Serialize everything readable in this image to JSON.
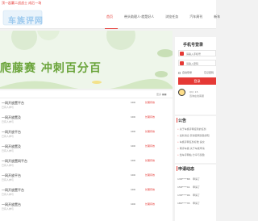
{
  "slogan": "顶一起赢二战战士 成后一场",
  "header": {
    "logo_text": "车族评网",
    "nav": [
      {
        "label": "首页",
        "active": true
      },
      {
        "label": "带头助理人·就是好人",
        "active": false
      },
      {
        "label": "浏览任务",
        "active": false
      },
      {
        "label": "汽车周刊",
        "active": false
      },
      {
        "label": "新车",
        "active": false
      }
    ]
  },
  "banner": {
    "text": "爬藤赛 冲刺百分百"
  },
  "login": {
    "title": "手机号登录",
    "username_placeholder": "请输入手机号",
    "password_placeholder": "请输入密码",
    "remember_label": "自动登录",
    "forgot_label": "忘记密码",
    "button_label": "登录",
    "qq_label": "QQ: 15",
    "qq_online": "咨询在线客服"
  },
  "list": {
    "more_label": "更多 ■■",
    "rows": [
      {
        "title": "一网开放置平台",
        "sub": "已有人参与",
        "num": "100",
        "status": "长期有效"
      },
      {
        "title": "一网开放置及",
        "sub": "已有人参与",
        "num": "100",
        "status": "长期有效"
      },
      {
        "title": "一网开放平台",
        "sub": "已有人参与",
        "num": "100",
        "status": "长期有效"
      },
      {
        "title": "一网开放置及",
        "sub": "已有人参与",
        "num": "100",
        "status": "长期有效"
      },
      {
        "title": "一网开放置网平台",
        "sub": "已有人参与",
        "num": "100",
        "status": "长期有效"
      },
      {
        "title": "一网开放平台",
        "sub": "已有人参与",
        "num": "100",
        "status": "长期有效"
      },
      {
        "title": "一网开放置平台",
        "sub": "已有人参与",
        "num": "100",
        "status": "长期有效"
      },
      {
        "title": "一网开放置台",
        "sub": "已有人参与",
        "num": "100",
        "status": "长期有效"
      }
    ]
  },
  "announcements": {
    "title": "公告",
    "items": [
      "关于车族评网接到的任务",
      "最新消息 获得官网奖励通知",
      "车族评网任务标准 提交",
      "网评车族·关于车族申请",
      "给车评网帖·分享与奖励"
    ]
  },
  "applications": {
    "title": "申请动态",
    "items": [
      {
        "name": "138****88",
        "action": "申请了"
      },
      {
        "name": "158****41",
        "action": "申请了"
      },
      {
        "name": "138****06",
        "action": "申请了"
      },
      {
        "name": "186****35",
        "action": "申请了"
      }
    ]
  }
}
